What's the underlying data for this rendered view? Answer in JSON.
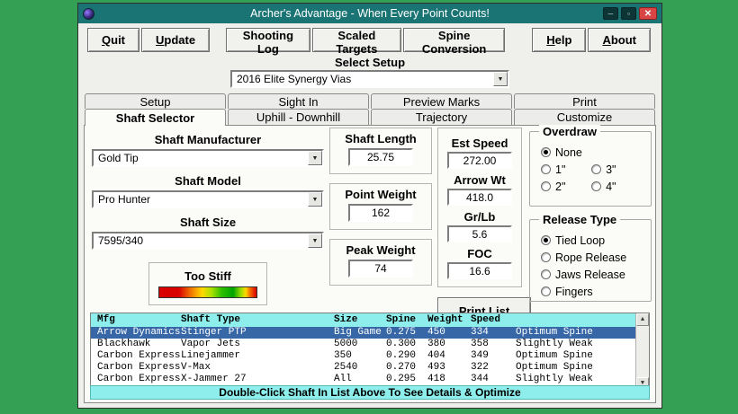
{
  "colors": {
    "desktop": "#33a054",
    "titlebar": "#1b7474",
    "close": "#d94444",
    "window_bg": "#efefec",
    "panel_bg": "#fbfbf8",
    "button_bg": "#f1f1ee",
    "cyan": "#8deeec",
    "row_selected": "#3767a6"
  },
  "icons": {
    "dropdown_arrow": "▼",
    "scroll_up": "▲",
    "scroll_down": "▼",
    "minimize": "─",
    "maximize": "▫",
    "close": "✕"
  },
  "window": {
    "title": "Archer's Advantage - When Every Point Counts!"
  },
  "toolbar": {
    "buttons": [
      {
        "label": "Quit",
        "accel": true
      },
      {
        "label": "Update",
        "accel": true
      },
      {
        "label": "Shooting Log"
      },
      {
        "label": "Scaled Targets"
      },
      {
        "label": "Spine Conversion"
      },
      {
        "label": "Help",
        "accel": true
      },
      {
        "label": "About",
        "accel": true
      }
    ]
  },
  "setup_select": {
    "label": "Select Setup",
    "value": "2016 Elite Synergy Vias"
  },
  "tabs_row1": [
    {
      "label": "Setup"
    },
    {
      "label": "Sight In"
    },
    {
      "label": "Preview Marks"
    },
    {
      "label": "Print"
    }
  ],
  "tabs_row2": [
    {
      "label": "Shaft Selector",
      "selected": true
    },
    {
      "label": "Uphill - Downhill"
    },
    {
      "label": "Trajectory"
    },
    {
      "label": "Customize"
    }
  ],
  "fields": {
    "manufacturer": {
      "label": "Shaft Manufacturer",
      "value": "Gold Tip"
    },
    "model": {
      "label": "Shaft Model",
      "value": "Pro Hunter"
    },
    "size": {
      "label": "Shaft Size",
      "value": "7595/340"
    },
    "shaft_length": {
      "label": "Shaft Length",
      "value": "25.75"
    },
    "point_weight": {
      "label": "Point Weight",
      "value": "162"
    },
    "peak_weight": {
      "label": "Peak Weight",
      "value": "74"
    },
    "est_speed": {
      "label": "Est Speed",
      "value": "272.00"
    },
    "arrow_wt": {
      "label": "Arrow Wt",
      "value": "418.0"
    },
    "gr_lb": {
      "label": "Gr/Lb",
      "value": "5.6"
    },
    "foc": {
      "label": "FOC",
      "value": "16.6"
    }
  },
  "gauge": {
    "label": "Too Stiff"
  },
  "print_list_label": "Print List",
  "overdraw": {
    "title": "Overdraw",
    "options": [
      {
        "label": "None",
        "selected": true,
        "wide": true
      },
      {
        "label": "1\""
      },
      {
        "label": "3\""
      },
      {
        "label": "2\""
      },
      {
        "label": "4\""
      }
    ]
  },
  "release_type": {
    "title": "Release Type",
    "options": [
      {
        "label": "Tied Loop",
        "selected": true
      },
      {
        "label": "Rope Release"
      },
      {
        "label": "Jaws Release"
      },
      {
        "label": "Fingers"
      }
    ]
  },
  "table": {
    "headers": {
      "mfg": "Mfg",
      "type": "Shaft Type",
      "size": "Size",
      "spine": "Spine",
      "weight": "Weight",
      "speed": "Speed"
    },
    "rows": [
      {
        "mfg": "Arrow Dynamics",
        "type": "Stinger PTP",
        "size": "Big Game",
        "spine": "0.275",
        "weight": "450",
        "speed": "334",
        "status": "Optimum Spine",
        "selected": true
      },
      {
        "mfg": "Blackhawk",
        "type": "Vapor Jets",
        "size": "5000",
        "spine": "0.300",
        "weight": "380",
        "speed": "358",
        "status": "Slightly Weak"
      },
      {
        "mfg": "Carbon Express",
        "type": "Linejammer",
        "size": "350",
        "spine": "0.290",
        "weight": "404",
        "speed": "349",
        "status": "Optimum Spine"
      },
      {
        "mfg": "Carbon Express",
        "type": "V-Max",
        "size": "2540",
        "spine": "0.270",
        "weight": "493",
        "speed": "322",
        "status": "Optimum Spine"
      },
      {
        "mfg": "Carbon Express",
        "type": "X-Jammer 27",
        "size": "All",
        "spine": "0.295",
        "weight": "418",
        "speed": "344",
        "status": "Slightly Weak"
      }
    ]
  },
  "footer": {
    "text": "Double-Click Shaft In List Above To See Details & Optimize"
  }
}
